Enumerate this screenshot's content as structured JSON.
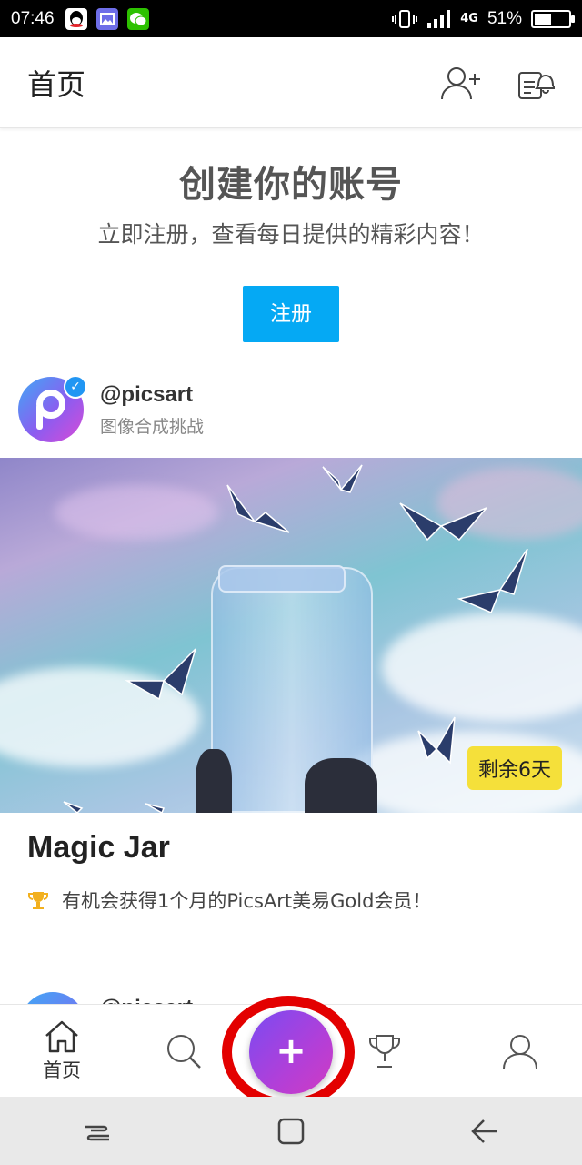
{
  "status_bar": {
    "time": "07:46",
    "network": "4G",
    "battery": "51%",
    "battery_level": 0.51
  },
  "header": {
    "title": "首页",
    "icons": [
      "add-friend-icon",
      "notifications-icon"
    ]
  },
  "signup": {
    "heading": "创建你的账号",
    "subheading": "立即注册，查看每日提供的精彩内容！",
    "button_label": "注册"
  },
  "post": {
    "username": "@picsart",
    "subtitle": "图像合成挑战",
    "badge": "剩余6天",
    "title": "Magic Jar",
    "reward": "有机会获得1个月的PicsArt美易Gold会员！"
  },
  "next_post": {
    "username": "@picsart"
  },
  "bottom_nav": {
    "home_label": "首页",
    "items": [
      "home-icon",
      "search-icon",
      "create-icon",
      "challenges-icon",
      "profile-icon"
    ]
  },
  "colors": {
    "accent": "#05a9f4",
    "fab": "#9b45e4",
    "highlight_ring": "#e30000",
    "badge": "#f5e03a"
  }
}
